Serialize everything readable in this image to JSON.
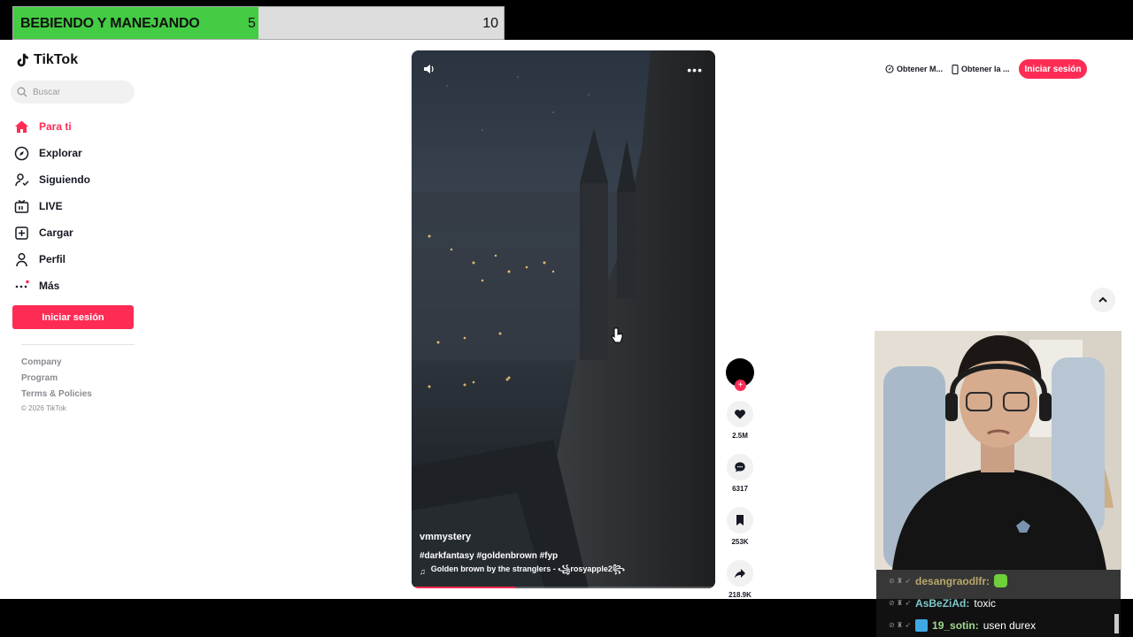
{
  "overlay": {
    "title": "BEBIENDO Y MANEJANDO",
    "current": "5",
    "target": "10",
    "progress_fraction": 0.5,
    "fill_color": "#44cc44"
  },
  "tiktok": {
    "logo_text": "TikTok",
    "search_placeholder": "Buscar",
    "nav": [
      {
        "label": "Para ti",
        "icon": "home-icon",
        "active": true
      },
      {
        "label": "Explorar",
        "icon": "compass-icon"
      },
      {
        "label": "Siguiendo",
        "icon": "following-icon"
      },
      {
        "label": "LIVE",
        "icon": "live-icon"
      },
      {
        "label": "Cargar",
        "icon": "upload-icon"
      },
      {
        "label": "Perfil",
        "icon": "profile-icon"
      },
      {
        "label": "Más",
        "icon": "more-icon"
      }
    ],
    "login_label": "Iniciar sesión",
    "footer_links": [
      "Company",
      "Program",
      "Terms & Policies"
    ],
    "copyright": "© 2026 TikTok",
    "top_right": {
      "coins": "Obtener M...",
      "app": "Obtener la ...",
      "login": "Iniciar sesión"
    },
    "accent_color": "#fe2c55"
  },
  "video": {
    "username": "vmmystery",
    "caption": "#darkfantasy #goldenbrown #fyp",
    "music": "Golden brown by the stranglers - ꧁rosyapple2꧂",
    "progress_fraction": 0.34,
    "actions": [
      {
        "icon": "heart-icon",
        "count": "2.5M"
      },
      {
        "icon": "comment-icon",
        "count": "6317"
      },
      {
        "icon": "bookmark-icon",
        "count": "253K"
      },
      {
        "icon": "share-icon",
        "count": "218.9K"
      }
    ]
  },
  "chat": [
    {
      "name": "desangraodlfr:",
      "text": "",
      "name_color": "#b8a86a",
      "emote": "frog"
    },
    {
      "name": "AsBeZiAd:",
      "text": "toxic",
      "name_color": "#7fc8c8"
    },
    {
      "name": "19_sotin:",
      "text": "usen durex",
      "name_color": "#9fd88c",
      "emote": "cube"
    }
  ]
}
